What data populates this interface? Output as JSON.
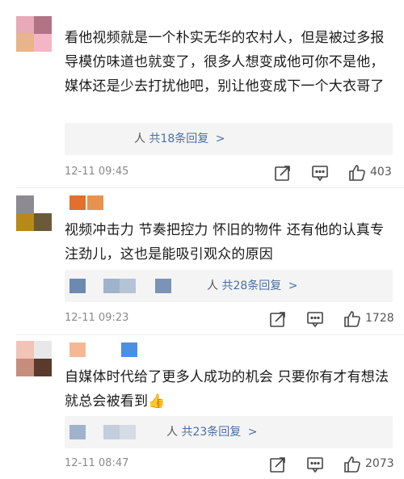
{
  "comments": [
    {
      "text": "看他视频就是一个朴实无华的农村人，但是被过多报导模仿味道也就变了，很多人想变成他可你不是他，媒体还是少去打扰他吧，别让他变成下一个大衣哥了",
      "reply_suffix": "人",
      "reply_label": "共18条回复",
      "reply_chevron": ">",
      "time": "12-11 09:45",
      "likes": "403"
    },
    {
      "text": "视频冲击力 节奏把控力 怀旧的物件 还有他的认真专注劲儿，这也是能吸引观众的原因",
      "reply_suffix": "人",
      "reply_label": "共28条回复",
      "reply_chevron": ">",
      "time": "12-11 09:23",
      "likes": "1728"
    },
    {
      "text": "自媒体时代给了更多人成功的机会 只要你有才有想法 就总会被看到👍",
      "reply_suffix": "人",
      "reply_label": "共23条回复",
      "reply_chevron": ">",
      "time": "12-11 08:47",
      "likes": "2073"
    }
  ],
  "icons": [
    "share-icon",
    "comment-icon",
    "like-icon"
  ],
  "colors": {
    "reply_link": "#4a6fa5",
    "meta_gray": "#8a8a8a",
    "reply_bg": "#f4f4f4"
  }
}
